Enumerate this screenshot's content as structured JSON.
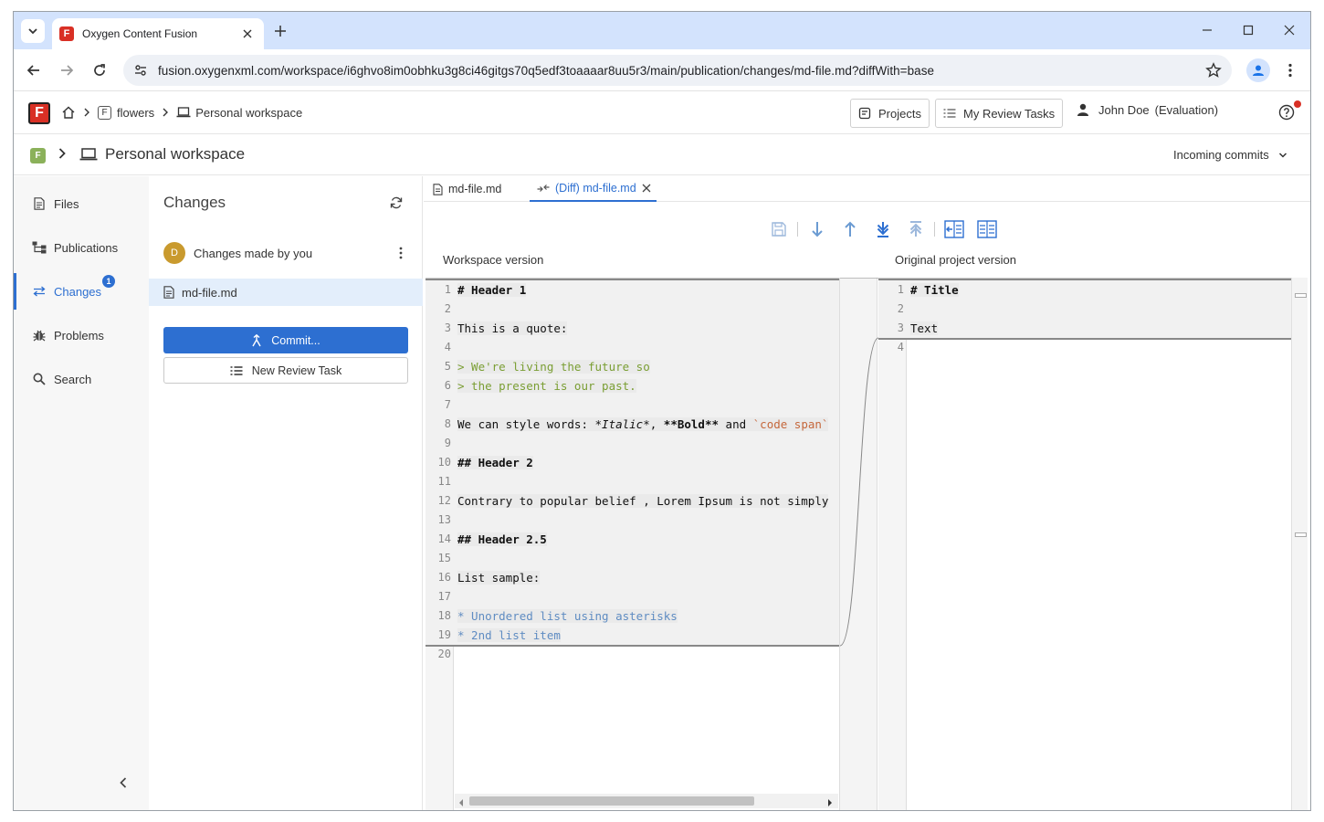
{
  "browser": {
    "tab_title": "Oxygen Content Fusion",
    "url": "fusion.oxygenxml.com/workspace/i6ghvo8im0obhku3g8ci46gitgs70q5edf3toaaaar8uu5r3/main/publication/changes/md-file.md?diffWith=base"
  },
  "header": {
    "logo_letter": "F",
    "crumb_project_badge": "F",
    "crumb_project": "flowers",
    "crumb_workspace": "Personal workspace",
    "projects_label": "Projects",
    "review_tasks_label": "My Review Tasks",
    "user_name": "John Doe",
    "user_mode": "(Evaluation)"
  },
  "workspace": {
    "badge": "F",
    "title": "Personal workspace",
    "incoming_label": "Incoming commits"
  },
  "nav": {
    "items": [
      {
        "label": "Files",
        "icon": "file-icon"
      },
      {
        "label": "Publications",
        "icon": "publication-icon"
      },
      {
        "label": "Changes",
        "icon": "changes-icon"
      },
      {
        "label": "Problems",
        "icon": "bug-icon"
      },
      {
        "label": "Search",
        "icon": "search-icon"
      }
    ],
    "changes_count": "1"
  },
  "changes": {
    "title": "Changes",
    "avatar_letter": "D",
    "group_label": "Changes made by you",
    "file_name": "md-file.md",
    "commit_label": "Commit...",
    "review_label": "New Review Task"
  },
  "editor": {
    "tabs": [
      {
        "label": "md-file.md"
      },
      {
        "label": "(Diff) md-file.md"
      }
    ],
    "left_label": "Workspace version",
    "right_label": "Original project version",
    "left_lines": [
      {
        "n": "1",
        "text": "# Header 1"
      },
      {
        "n": "2",
        "text": ""
      },
      {
        "n": "3",
        "text": "This is a quote:"
      },
      {
        "n": "4",
        "text": ""
      },
      {
        "n": "5",
        "text": "> We're living the future so"
      },
      {
        "n": "6",
        "text": "> the present is our past."
      },
      {
        "n": "7",
        "text": ""
      },
      {
        "n": "8",
        "text": "We can style words: *Italic*, **Bold** and `code span`"
      },
      {
        "n": "9",
        "text": ""
      },
      {
        "n": "10",
        "text": "## Header 2"
      },
      {
        "n": "11",
        "text": ""
      },
      {
        "n": "12",
        "text": "Contrary to popular belief , Lorem Ipsum is not simply"
      },
      {
        "n": "13",
        "text": ""
      },
      {
        "n": "14",
        "text": "## Header 2.5"
      },
      {
        "n": "15",
        "text": ""
      },
      {
        "n": "16",
        "text": "List sample:"
      },
      {
        "n": "17",
        "text": ""
      },
      {
        "n": "18",
        "text": "* Unordered list using asterisks"
      },
      {
        "n": "19",
        "text": "* 2nd list item"
      },
      {
        "n": "20",
        "text": ""
      }
    ],
    "right_lines": [
      {
        "n": "1",
        "text": "# Title"
      },
      {
        "n": "2",
        "text": ""
      },
      {
        "n": "3",
        "text": "Text"
      },
      {
        "n": "4",
        "text": ""
      }
    ]
  },
  "colors": {
    "accent": "#2d6fd1",
    "brand_red": "#d93025",
    "quote_green": "#7a9e33",
    "list_blue": "#5f8cc2",
    "code_orange": "#c5673b"
  }
}
